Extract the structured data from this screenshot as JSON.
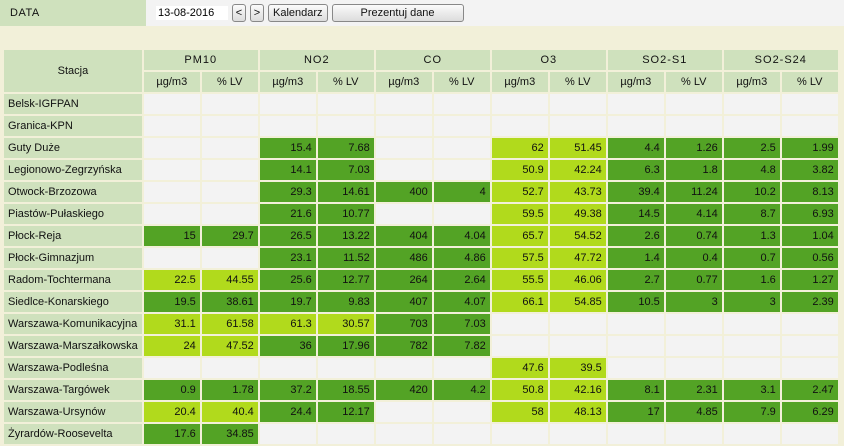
{
  "header": {
    "label": "DATA",
    "date_value": "13-08-2016",
    "prev_label": "<",
    "next_label": ">",
    "calendar_label": "Kalendarz",
    "present_label": "Prezentuj dane"
  },
  "table": {
    "station_header": "Stacja",
    "groups": [
      "PM10",
      "NO2",
      "CO",
      "O3",
      "SO2-S1",
      "SO2-S24"
    ],
    "units": [
      "µg/m3",
      "% LV"
    ],
    "level_colors": {
      "e": "#f3f3f3",
      "d": "#53a325",
      "l": "#b1da1c"
    },
    "rows": [
      {
        "station": "Belsk-IGFPAN",
        "cells": [
          [
            "",
            ""
          ],
          [
            "",
            ""
          ],
          [
            "",
            ""
          ],
          [
            "",
            ""
          ],
          [
            "",
            ""
          ],
          [
            "",
            ""
          ]
        ],
        "levels": [
          "e",
          "e",
          "e",
          "e",
          "e",
          "e",
          "e",
          "e",
          "e",
          "e",
          "e",
          "e"
        ]
      },
      {
        "station": "Granica-KPN",
        "cells": [
          [
            "",
            ""
          ],
          [
            "",
            ""
          ],
          [
            "",
            ""
          ],
          [
            "",
            ""
          ],
          [
            "",
            ""
          ],
          [
            "",
            ""
          ]
        ],
        "levels": [
          "e",
          "e",
          "e",
          "e",
          "e",
          "e",
          "e",
          "e",
          "e",
          "e",
          "e",
          "e"
        ]
      },
      {
        "station": "Guty Duże",
        "cells": [
          [
            "",
            ""
          ],
          [
            "15.4",
            "7.68"
          ],
          [
            "",
            ""
          ],
          [
            "62",
            "51.45"
          ],
          [
            "4.4",
            "1.26"
          ],
          [
            "2.5",
            "1.99"
          ]
        ],
        "levels": [
          "e",
          "e",
          "d",
          "d",
          "e",
          "e",
          "l",
          "l",
          "d",
          "d",
          "d",
          "d"
        ]
      },
      {
        "station": "Legionowo-Zegrzyńska",
        "cells": [
          [
            "",
            ""
          ],
          [
            "14.1",
            "7.03"
          ],
          [
            "",
            ""
          ],
          [
            "50.9",
            "42.24"
          ],
          [
            "6.3",
            "1.8"
          ],
          [
            "4.8",
            "3.82"
          ]
        ],
        "levels": [
          "e",
          "e",
          "d",
          "d",
          "e",
          "e",
          "l",
          "l",
          "d",
          "d",
          "d",
          "d"
        ]
      },
      {
        "station": "Otwock-Brzozowa",
        "cells": [
          [
            "",
            ""
          ],
          [
            "29.3",
            "14.61"
          ],
          [
            "400",
            "4"
          ],
          [
            "52.7",
            "43.73"
          ],
          [
            "39.4",
            "11.24"
          ],
          [
            "10.2",
            "8.13"
          ]
        ],
        "levels": [
          "e",
          "e",
          "d",
          "d",
          "d",
          "d",
          "l",
          "l",
          "d",
          "d",
          "d",
          "d"
        ]
      },
      {
        "station": "Piastów-Pułaskiego",
        "cells": [
          [
            "",
            ""
          ],
          [
            "21.6",
            "10.77"
          ],
          [
            "",
            ""
          ],
          [
            "59.5",
            "49.38"
          ],
          [
            "14.5",
            "4.14"
          ],
          [
            "8.7",
            "6.93"
          ]
        ],
        "levels": [
          "e",
          "e",
          "d",
          "d",
          "e",
          "e",
          "l",
          "l",
          "d",
          "d",
          "d",
          "d"
        ]
      },
      {
        "station": "Płock-Reja",
        "cells": [
          [
            "15",
            "29.7"
          ],
          [
            "26.5",
            "13.22"
          ],
          [
            "404",
            "4.04"
          ],
          [
            "65.7",
            "54.52"
          ],
          [
            "2.6",
            "0.74"
          ],
          [
            "1.3",
            "1.04"
          ]
        ],
        "levels": [
          "d",
          "d",
          "d",
          "d",
          "d",
          "d",
          "l",
          "l",
          "d",
          "d",
          "d",
          "d"
        ]
      },
      {
        "station": "Płock-Gimnazjum",
        "cells": [
          [
            "",
            ""
          ],
          [
            "23.1",
            "11.52"
          ],
          [
            "486",
            "4.86"
          ],
          [
            "57.5",
            "47.72"
          ],
          [
            "1.4",
            "0.4"
          ],
          [
            "0.7",
            "0.56"
          ]
        ],
        "levels": [
          "e",
          "e",
          "d",
          "d",
          "d",
          "d",
          "l",
          "l",
          "d",
          "d",
          "d",
          "d"
        ]
      },
      {
        "station": "Radom-Tochtermana",
        "cells": [
          [
            "22.5",
            "44.55"
          ],
          [
            "25.6",
            "12.77"
          ],
          [
            "264",
            "2.64"
          ],
          [
            "55.5",
            "46.06"
          ],
          [
            "2.7",
            "0.77"
          ],
          [
            "1.6",
            "1.27"
          ]
        ],
        "levels": [
          "l",
          "l",
          "d",
          "d",
          "d",
          "d",
          "l",
          "l",
          "d",
          "d",
          "d",
          "d"
        ]
      },
      {
        "station": "Siedlce-Konarskiego",
        "cells": [
          [
            "19.5",
            "38.61"
          ],
          [
            "19.7",
            "9.83"
          ],
          [
            "407",
            "4.07"
          ],
          [
            "66.1",
            "54.85"
          ],
          [
            "10.5",
            "3"
          ],
          [
            "3",
            "2.39"
          ]
        ],
        "levels": [
          "d",
          "d",
          "d",
          "d",
          "d",
          "d",
          "l",
          "l",
          "d",
          "d",
          "d",
          "d"
        ]
      },
      {
        "station": "Warszawa-Komunikacyjna",
        "cells": [
          [
            "31.1",
            "61.58"
          ],
          [
            "61.3",
            "30.57"
          ],
          [
            "703",
            "7.03"
          ],
          [
            "",
            ""
          ],
          [
            "",
            ""
          ],
          [
            "",
            ""
          ]
        ],
        "levels": [
          "l",
          "l",
          "l",
          "l",
          "d",
          "d",
          "e",
          "e",
          "e",
          "e",
          "e",
          "e"
        ]
      },
      {
        "station": "Warszawa-Marszałkowska",
        "cells": [
          [
            "24",
            "47.52"
          ],
          [
            "36",
            "17.96"
          ],
          [
            "782",
            "7.82"
          ],
          [
            "",
            ""
          ],
          [
            "",
            ""
          ],
          [
            "",
            ""
          ]
        ],
        "levels": [
          "l",
          "l",
          "d",
          "d",
          "d",
          "d",
          "e",
          "e",
          "e",
          "e",
          "e",
          "e"
        ]
      },
      {
        "station": "Warszawa-Podleśna",
        "cells": [
          [
            "",
            ""
          ],
          [
            "",
            ""
          ],
          [
            "",
            ""
          ],
          [
            "47.6",
            "39.5"
          ],
          [
            "",
            ""
          ],
          [
            "",
            ""
          ]
        ],
        "levels": [
          "e",
          "e",
          "e",
          "e",
          "e",
          "e",
          "l",
          "l",
          "e",
          "e",
          "e",
          "e"
        ]
      },
      {
        "station": "Warszawa-Targówek",
        "cells": [
          [
            "0.9",
            "1.78"
          ],
          [
            "37.2",
            "18.55"
          ],
          [
            "420",
            "4.2"
          ],
          [
            "50.8",
            "42.16"
          ],
          [
            "8.1",
            "2.31"
          ],
          [
            "3.1",
            "2.47"
          ]
        ],
        "levels": [
          "d",
          "d",
          "d",
          "d",
          "d",
          "d",
          "l",
          "l",
          "d",
          "d",
          "d",
          "d"
        ]
      },
      {
        "station": "Warszawa-Ursynów",
        "cells": [
          [
            "20.4",
            "40.4"
          ],
          [
            "24.4",
            "12.17"
          ],
          [
            "",
            ""
          ],
          [
            "58",
            "48.13"
          ],
          [
            "17",
            "4.85"
          ],
          [
            "7.9",
            "6.29"
          ]
        ],
        "levels": [
          "l",
          "l",
          "d",
          "d",
          "e",
          "e",
          "l",
          "l",
          "d",
          "d",
          "d",
          "d"
        ]
      },
      {
        "station": "Żyrardów-Roosevelta",
        "cells": [
          [
            "17.6",
            "34.85"
          ],
          [
            "",
            ""
          ],
          [
            "",
            ""
          ],
          [
            "",
            ""
          ],
          [
            "",
            ""
          ],
          [
            "",
            ""
          ]
        ],
        "levels": [
          "d",
          "d",
          "e",
          "e",
          "e",
          "e",
          "e",
          "e",
          "e",
          "e",
          "e",
          "e"
        ]
      }
    ]
  }
}
